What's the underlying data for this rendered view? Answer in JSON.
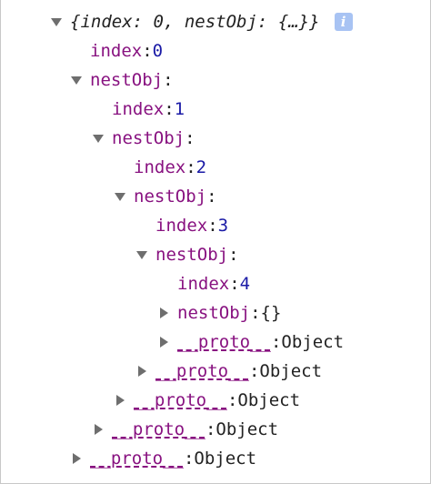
{
  "console": {
    "summary": "{index: 0, nestObj: {…}}",
    "info_glyph": "i",
    "tree": [
      {
        "type": "root-summary",
        "expanded": true
      },
      {
        "type": "prop",
        "key": "index",
        "sep": ": ",
        "value": "0"
      },
      {
        "type": "prop",
        "key": "nestObj",
        "sep": ":",
        "expanded": true
      },
      {
        "type": "prop",
        "key": "index",
        "sep": ": ",
        "value": "1"
      },
      {
        "type": "prop",
        "key": "nestObj",
        "sep": ":",
        "expanded": true
      },
      {
        "type": "prop",
        "key": "index",
        "sep": ": ",
        "value": "2"
      },
      {
        "type": "prop",
        "key": "nestObj",
        "sep": ":",
        "expanded": true
      },
      {
        "type": "prop",
        "key": "index",
        "sep": ": ",
        "value": "3"
      },
      {
        "type": "prop",
        "key": "nestObj",
        "sep": ":",
        "expanded": true
      },
      {
        "type": "prop",
        "key": "index",
        "sep": ": ",
        "value": "4"
      },
      {
        "type": "prop",
        "key": "nestObj",
        "sep": ": ",
        "value": "{}",
        "expanded": false
      },
      {
        "type": "proto",
        "key": "__proto__",
        "sep": ": ",
        "value": "Object",
        "expanded": false
      },
      {
        "type": "proto",
        "key": "__proto__",
        "sep": ": ",
        "value": "Object",
        "expanded": false
      },
      {
        "type": "proto",
        "key": "__proto__",
        "sep": ": ",
        "value": "Object",
        "expanded": false
      },
      {
        "type": "proto",
        "key": "__proto__",
        "sep": ": ",
        "value": "Object",
        "expanded": false
      },
      {
        "type": "proto",
        "key": "__proto__",
        "sep": ": ",
        "value": "Object",
        "expanded": false
      }
    ]
  },
  "colors": {
    "key": "#881280",
    "number": "#1a1aa6",
    "text": "#222222",
    "toggle": "#6e6e6e",
    "info_badge": "#a8c3f3"
  }
}
